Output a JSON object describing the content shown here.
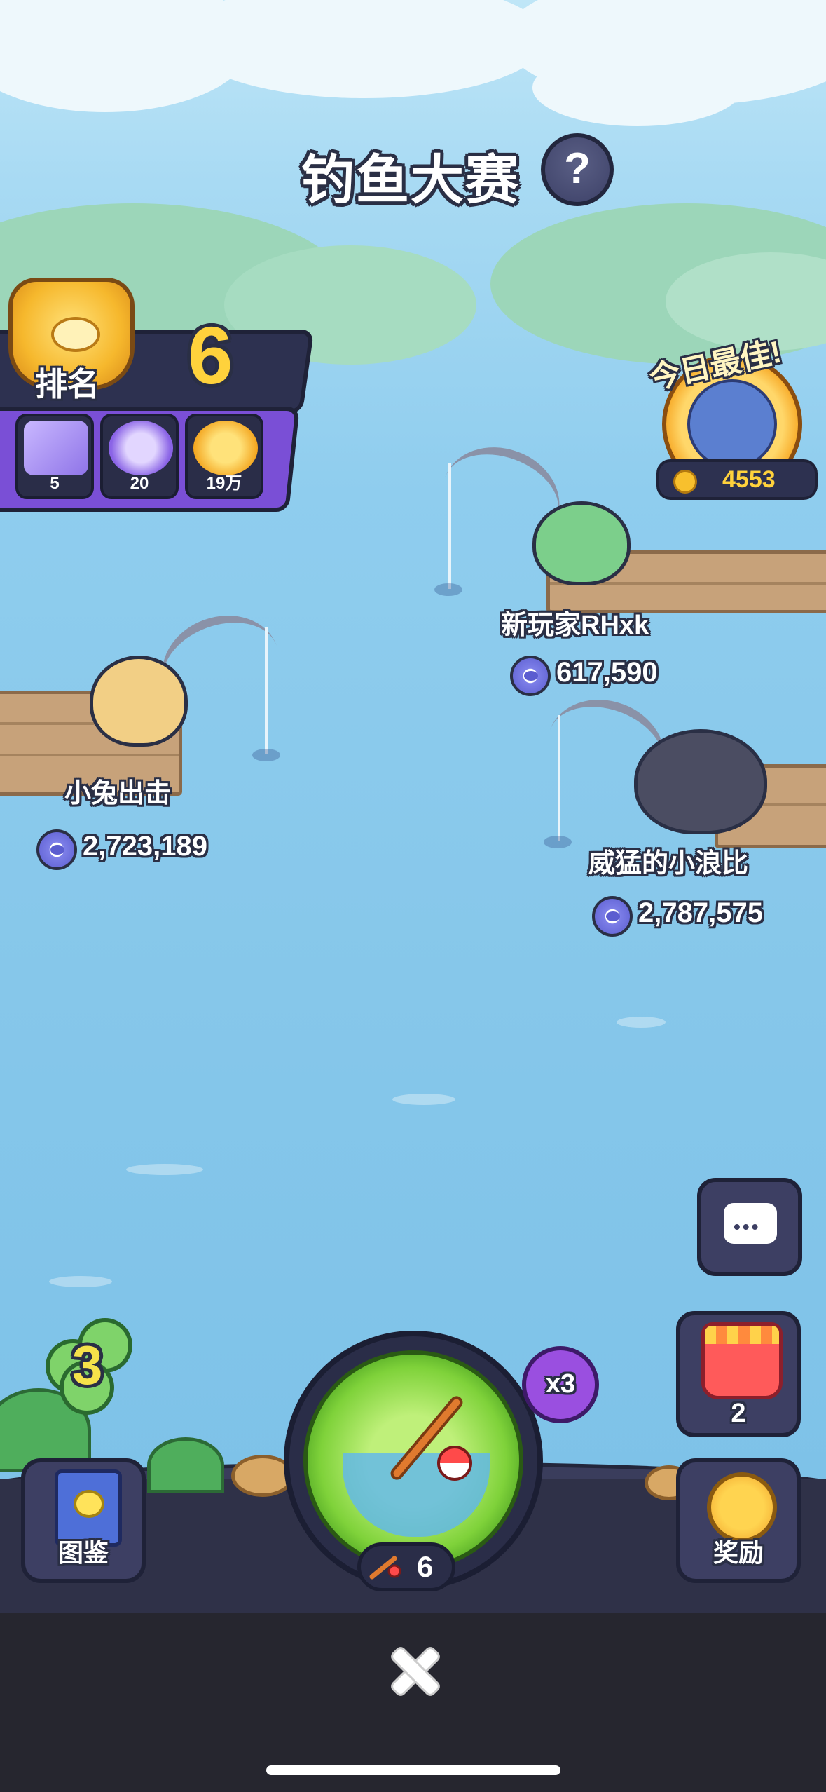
{
  "header": {
    "title": "钓鱼大赛",
    "help_symbol": "?"
  },
  "ranking": {
    "label": "排名",
    "value": "6",
    "prizes": [
      {
        "icon": "mystery-box-icon",
        "count": "5"
      },
      {
        "icon": "capsule-icon",
        "count": "20"
      },
      {
        "icon": "gold-coins-icon",
        "count": "19万"
      }
    ]
  },
  "best_today": {
    "title": "今日最佳!",
    "score": "4553"
  },
  "players": [
    {
      "name": "新玩家RHxk",
      "score": "617,590"
    },
    {
      "name": "小兔出击",
      "score": "2,723,189"
    },
    {
      "name": "威猛的小浪比",
      "score": "2,787,575"
    }
  ],
  "controls": {
    "clover_count": "3",
    "multiplier": "x3",
    "rod_count": "6",
    "bag_count": "2",
    "guide_label": "图鉴",
    "reward_label": "奖励",
    "chat_symbol": "•••"
  },
  "colors": {
    "accent_purple": "#7a4fd6",
    "gold": "#ffd23c",
    "panel_dark": "#2d3150",
    "green": "#7fd23a"
  }
}
